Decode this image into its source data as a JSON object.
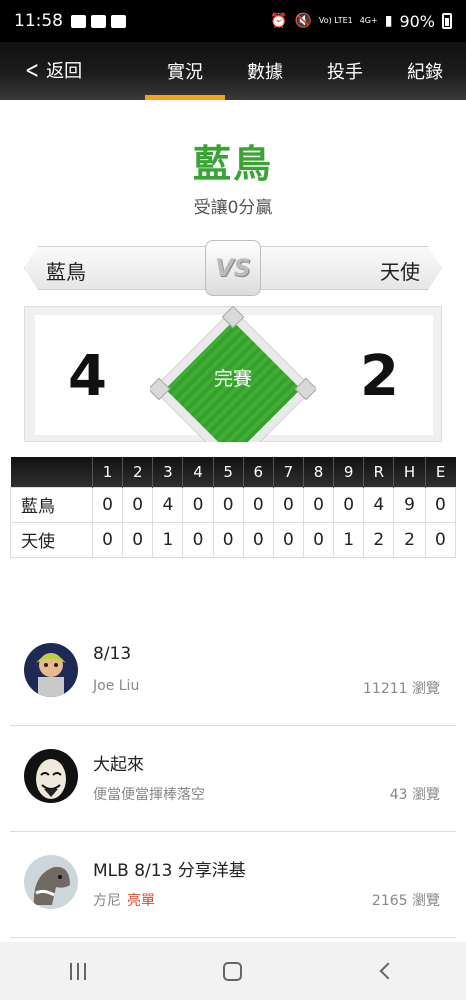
{
  "status_bar": {
    "time": "11:58",
    "battery": "90%",
    "network": "4G+",
    "lte": "Vo) LTE1"
  },
  "nav": {
    "back_label": "返回",
    "tabs": [
      "實況",
      "數據",
      "投手",
      "紀錄"
    ],
    "active_tab": 0
  },
  "game": {
    "winner": "藍鳥",
    "handicap": "受讓0分贏",
    "home_team": "藍鳥",
    "away_team": "天使",
    "vs": "VS",
    "home_score": "4",
    "away_score": "2",
    "status": "完賽"
  },
  "linescore": {
    "headers": [
      "",
      "1",
      "2",
      "3",
      "4",
      "5",
      "6",
      "7",
      "8",
      "9",
      "R",
      "H",
      "E"
    ],
    "rows": [
      {
        "team": "藍鳥",
        "values": [
          "0",
          "0",
          "4",
          "0",
          "0",
          "0",
          "0",
          "0",
          "0",
          "4",
          "9",
          "0"
        ]
      },
      {
        "team": "天使",
        "values": [
          "0",
          "0",
          "1",
          "0",
          "0",
          "0",
          "0",
          "0",
          "1",
          "2",
          "2",
          "0"
        ]
      }
    ]
  },
  "posts": [
    {
      "title": "8/13",
      "author": "Joe Liu",
      "tag": "",
      "views": "11211 瀏覽"
    },
    {
      "title": "大起來",
      "author": "便當便當揮棒落空",
      "tag": "",
      "views": "43 瀏覽"
    },
    {
      "title": "MLB 8/13 分享洋基",
      "author": "方尼",
      "tag": "亮單",
      "views": "2165 瀏覽"
    }
  ],
  "colors": {
    "accent": "#f6a11a",
    "winner": "#3aa335",
    "field": "#3fae35",
    "tag": "#e0472b"
  }
}
